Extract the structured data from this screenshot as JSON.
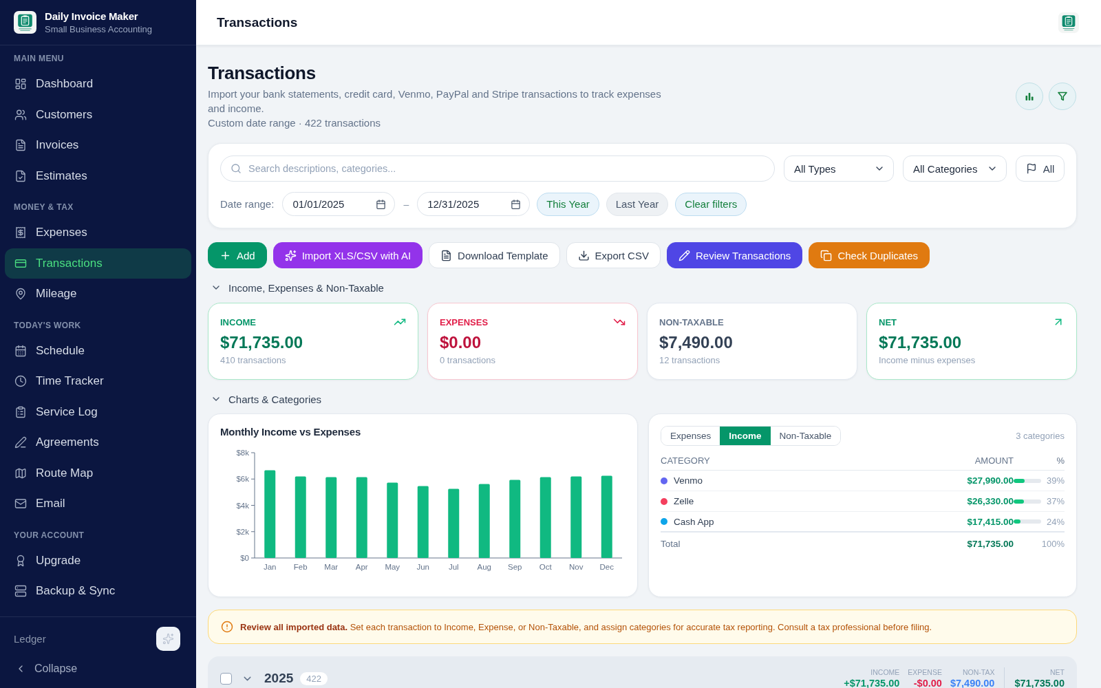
{
  "sidebar": {
    "app_name": "Daily Invoice Maker",
    "app_subtitle": "Small Business Accounting",
    "sections": [
      {
        "title": "MAIN MENU",
        "items": [
          {
            "label": "Dashboard",
            "selected": false
          },
          {
            "label": "Customers",
            "selected": false
          },
          {
            "label": "Invoices",
            "selected": false
          },
          {
            "label": "Estimates",
            "selected": false
          }
        ]
      },
      {
        "title": "MONEY & TAX",
        "items": [
          {
            "label": "Expenses",
            "selected": false
          },
          {
            "label": "Transactions",
            "selected": true
          },
          {
            "label": "Mileage",
            "selected": false
          }
        ]
      },
      {
        "title": "TODAY'S WORK",
        "items": [
          {
            "label": "Schedule",
            "selected": false
          },
          {
            "label": "Time Tracker",
            "selected": false
          },
          {
            "label": "Service Log",
            "selected": false
          },
          {
            "label": "Agreements",
            "selected": false
          },
          {
            "label": "Route Map",
            "selected": false
          },
          {
            "label": "Email",
            "selected": false
          }
        ]
      },
      {
        "title": "YOUR ACCOUNT",
        "items": [
          {
            "label": "Upgrade",
            "selected": false
          },
          {
            "label": "Backup & Sync",
            "selected": false
          }
        ]
      }
    ],
    "footer_label": "Ledger",
    "collapse_label": "Collapse"
  },
  "topbar": {
    "title": "Transactions"
  },
  "header": {
    "title": "Transactions",
    "description": "Import your bank statements, credit card, Venmo, PayPal and Stripe transactions to track expenses and income.",
    "meta": "Custom date range · 422 transactions"
  },
  "filters": {
    "search": {
      "placeholder": "Search descriptions, categories..."
    },
    "type_select": {
      "value": "All Types"
    },
    "category_select": {
      "value": "All Categories"
    },
    "flag_filter": {
      "label": "All"
    },
    "date_range": {
      "label": "Date range:",
      "from": "01/01/2025",
      "separator": "–",
      "to": "12/31/2025"
    },
    "presets": [
      {
        "label": "This Year",
        "selected": true
      },
      {
        "label": "Last Year",
        "selected": false
      }
    ],
    "clear_button": {
      "label": "Clear filters"
    }
  },
  "actions": [
    {
      "label": "Add",
      "kind": "primary"
    },
    {
      "label": "Import XLS/CSV with AI",
      "kind": "magic"
    },
    {
      "label": "Download Template",
      "kind": "plain"
    },
    {
      "label": "Export CSV",
      "kind": "plain"
    },
    {
      "label": "Review Transactions",
      "kind": "review"
    },
    {
      "label": "Check Duplicates",
      "kind": "warning"
    }
  ],
  "summary": {
    "title": "Income, Expenses & Non-Taxable",
    "expanded": true,
    "cards": [
      {
        "kind": "income",
        "label": "INCOME",
        "amount": "$71,735.00",
        "note": "410 transactions"
      },
      {
        "kind": "expense",
        "label": "EXPENSES",
        "amount": "$0.00",
        "note": "0 transactions"
      },
      {
        "kind": "non_taxable",
        "label": "NON-TAXABLE",
        "amount": "$7,490.00",
        "note": "12 transactions"
      },
      {
        "kind": "net",
        "label": "NET",
        "amount": "$71,735.00",
        "note": "Income minus expenses"
      }
    ]
  },
  "charts": {
    "title": "Charts & Categories",
    "expanded": true,
    "monthly": {
      "chart_data": {
        "type": "bar",
        "title": "Monthly Income vs Expenses",
        "categories": [
          "Jan",
          "Feb",
          "Mar",
          "Apr",
          "May",
          "Jun",
          "Jul",
          "Aug",
          "Sep",
          "Oct",
          "Nov",
          "Dec"
        ],
        "values": [
          6670,
          6190,
          6150,
          6150,
          5720,
          5470,
          5250,
          5620,
          5940,
          6150,
          6190,
          6250
        ],
        "ylim": [
          0,
          8000
        ],
        "yticks": [
          {
            "value": 0,
            "label": "$0"
          },
          {
            "value": 2000,
            "label": "$2k"
          },
          {
            "value": 4000,
            "label": "$4k"
          },
          {
            "value": 6000,
            "label": "$6k"
          },
          {
            "value": 8000,
            "label": "$8k"
          }
        ]
      }
    },
    "categories": {
      "tabs": [
        {
          "label": "Expenses",
          "selected": false
        },
        {
          "label": "Income",
          "selected": true
        },
        {
          "label": "Non-Taxable",
          "selected": false
        }
      ],
      "count": "3 categories",
      "columns": [
        "CATEGORY",
        "AMOUNT",
        "%"
      ],
      "rows": [
        {
          "name": "Venmo",
          "color": "#6366f1",
          "amount": "$27,990.00",
          "level": 0.39,
          "percent": "39%"
        },
        {
          "name": "Zelle",
          "color": "#f43f5e",
          "amount": "$26,330.00",
          "level": 0.37,
          "percent": "37%"
        },
        {
          "name": "Cash App",
          "color": "#0ea5e9",
          "amount": "$17,415.00",
          "level": 0.24,
          "percent": "24%"
        }
      ],
      "total": {
        "label": "Total",
        "amount": "$71,735.00",
        "percent": "100%"
      }
    }
  },
  "notice": {
    "text": "**Review all imported data.** Set each transaction to Income, Expense, or Non-Taxable, and assign categories for accurate tax reporting. Consult a tax professional before filing."
  },
  "year_group": {
    "year": "2025",
    "count": "422",
    "checked": false,
    "expanded": true,
    "stats": [
      {
        "kind": "income",
        "label": "INCOME",
        "value": "+$71,735.00"
      },
      {
        "kind": "expense",
        "label": "EXPENSE",
        "value": "-$0.00"
      },
      {
        "kind": "non_taxable",
        "label": "NON-TAX",
        "value": "$7,490.00"
      },
      {
        "kind": "net",
        "label": "NET",
        "value": "$71,735.00"
      }
    ]
  }
}
